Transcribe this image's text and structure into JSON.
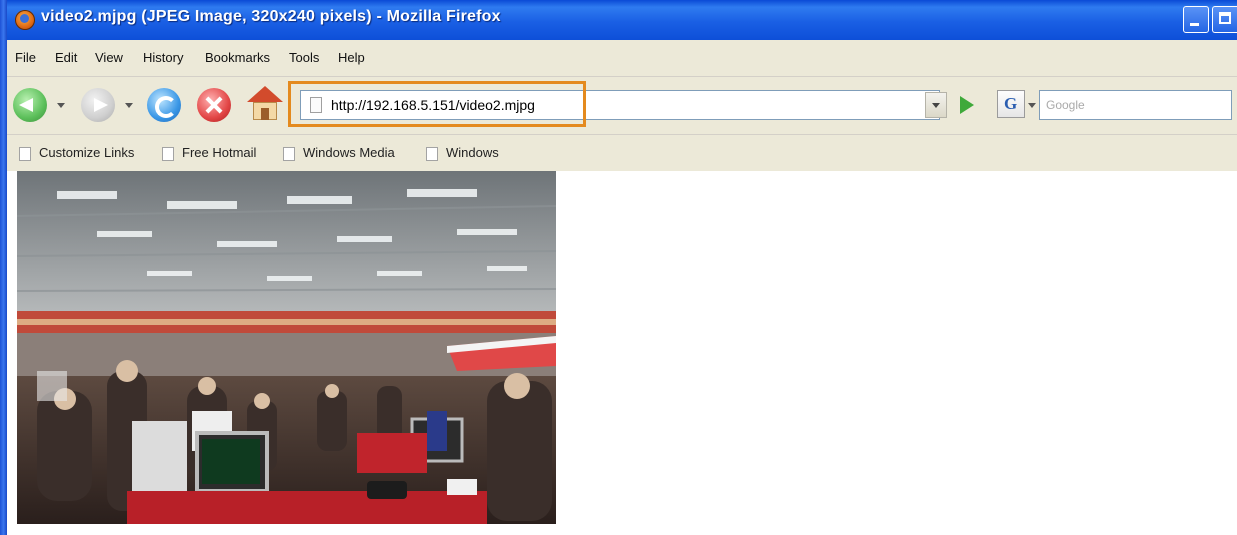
{
  "window": {
    "title": "video2.mjpg (JPEG Image, 320x240 pixels) - Mozilla Firefox"
  },
  "menu": [
    "File",
    "Edit",
    "View",
    "History",
    "Bookmarks",
    "Tools",
    "Help"
  ],
  "navigation": {
    "url": "http://192.168.5.151/video2.mjpg",
    "search_placeholder": "Google",
    "search_engine_icon": "G"
  },
  "bookmarks": [
    "Customize Links",
    "Free Hotmail",
    "Windows Media",
    "Windows"
  ],
  "content": {
    "image_description": "MJPEG camera frame"
  },
  "colors": {
    "titlebar": "#1a5fe4",
    "chrome": "#ece9d8",
    "url_highlight": "#e48a1e"
  }
}
